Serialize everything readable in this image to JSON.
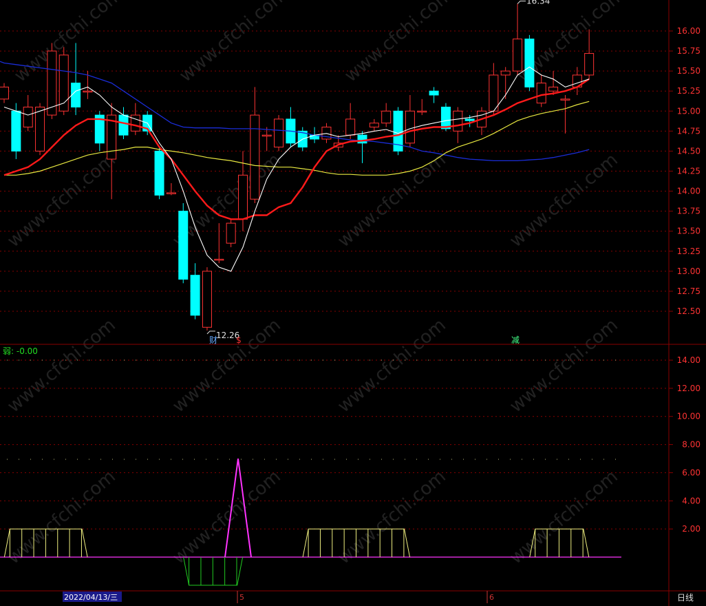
{
  "ui": {
    "indicator_label": "弱: -0.00",
    "date_box": "2022/04/13/三",
    "month_marks": [
      "5",
      "6"
    ],
    "period_tab": "日线",
    "watermark": "www.cfchi.com",
    "event_markers": [
      "财",
      "$",
      "减"
    ],
    "max_price_label": "16.34",
    "min_price_label": "12.26"
  },
  "colors": {
    "background": "#000000",
    "grid": "#8a0000",
    "axis_text": "#ff3333",
    "up": "#ff3333",
    "down": "#00ffff",
    "ma_white": "#ffffff",
    "ma_red": "#ff1a1a",
    "ma_yellow": "#e8e840",
    "ma_blue": "#1a2dd8",
    "indicator_yellow": "#f0f080",
    "indicator_green": "#22cc22",
    "indicator_magenta": "#ff33ff"
  },
  "chart_data": [
    {
      "type": "candlestick",
      "ylim": [
        12.0,
        16.3
      ],
      "yticks": [
        "12.50",
        "12.75",
        "13.00",
        "13.25",
        "13.50",
        "13.75",
        "14.00",
        "14.25",
        "14.50",
        "14.75",
        "15.00",
        "15.25",
        "15.50",
        "15.75",
        "16.00"
      ],
      "candles": [
        {
          "o": 15.15,
          "c": 15.3,
          "h": 15.35,
          "l": 15.1
        },
        {
          "o": 15.0,
          "c": 14.5,
          "h": 15.1,
          "l": 14.4
        },
        {
          "o": 14.8,
          "c": 15.05,
          "h": 15.2,
          "l": 14.75
        },
        {
          "o": 14.5,
          "c": 15.05,
          "h": 15.1,
          "l": 14.45
        },
        {
          "o": 14.95,
          "c": 15.75,
          "h": 15.85,
          "l": 14.9
        },
        {
          "o": 15.0,
          "c": 15.7,
          "h": 15.8,
          "l": 14.95
        },
        {
          "o": 15.35,
          "c": 15.05,
          "h": 15.85,
          "l": 14.95
        },
        {
          "o": 15.25,
          "c": 15.25,
          "h": 15.5,
          "l": 15.15
        },
        {
          "o": 14.95,
          "c": 14.6,
          "h": 15.0,
          "l": 14.5
        },
        {
          "o": 14.4,
          "c": 14.95,
          "h": 15.1,
          "l": 13.9
        },
        {
          "o": 14.95,
          "c": 14.7,
          "h": 15.05,
          "l": 14.65
        },
        {
          "o": 14.75,
          "c": 14.95,
          "h": 15.1,
          "l": 14.7
        },
        {
          "o": 14.95,
          "c": 14.75,
          "h": 15.0,
          "l": 14.7
        },
        {
          "o": 14.5,
          "c": 13.95,
          "h": 14.55,
          "l": 13.9
        },
        {
          "o": 13.98,
          "c": 13.98,
          "h": 14.1,
          "l": 13.95
        },
        {
          "o": 13.75,
          "c": 12.9,
          "h": 13.85,
          "l": 12.85
        },
        {
          "o": 12.95,
          "c": 12.45,
          "h": 13.1,
          "l": 12.4
        },
        {
          "o": 12.3,
          "c": 13.0,
          "h": 13.05,
          "l": 12.26
        },
        {
          "o": 13.15,
          "c": 13.15,
          "h": 13.6,
          "l": 13.1
        },
        {
          "o": 13.35,
          "c": 13.6,
          "h": 13.65,
          "l": 13.3
        },
        {
          "o": 13.65,
          "c": 14.2,
          "h": 14.5,
          "l": 13.5
        },
        {
          "o": 13.9,
          "c": 14.95,
          "h": 15.3,
          "l": 13.85
        },
        {
          "o": 14.7,
          "c": 14.7,
          "h": 14.8,
          "l": 14.5
        },
        {
          "o": 14.55,
          "c": 14.9,
          "h": 14.95,
          "l": 14.5
        },
        {
          "o": 14.9,
          "c": 14.6,
          "h": 15.05,
          "l": 14.55
        },
        {
          "o": 14.75,
          "c": 14.55,
          "h": 14.8,
          "l": 14.5
        },
        {
          "o": 14.7,
          "c": 14.65,
          "h": 14.8,
          "l": 14.6
        },
        {
          "o": 14.65,
          "c": 14.8,
          "h": 14.85,
          "l": 14.6
        },
        {
          "o": 14.55,
          "c": 14.6,
          "h": 14.7,
          "l": 14.5
        },
        {
          "o": 14.7,
          "c": 14.9,
          "h": 15.1,
          "l": 14.65
        },
        {
          "o": 14.7,
          "c": 14.6,
          "h": 14.75,
          "l": 14.35
        },
        {
          "o": 14.8,
          "c": 14.85,
          "h": 14.9,
          "l": 14.75
        },
        {
          "o": 14.85,
          "c": 15.0,
          "h": 15.1,
          "l": 14.8
        },
        {
          "o": 15.0,
          "c": 14.5,
          "h": 15.05,
          "l": 14.45
        },
        {
          "o": 14.6,
          "c": 15.0,
          "h": 15.2,
          "l": 14.55
        },
        {
          "o": 15.0,
          "c": 15.0,
          "h": 15.15,
          "l": 14.95
        },
        {
          "o": 15.25,
          "c": 15.2,
          "h": 15.3,
          "l": 15.1
        },
        {
          "o": 15.05,
          "c": 14.78,
          "h": 15.1,
          "l": 14.75
        },
        {
          "o": 14.75,
          "c": 15.0,
          "h": 15.05,
          "l": 14.6
        },
        {
          "o": 14.9,
          "c": 14.88,
          "h": 14.95,
          "l": 14.8
        },
        {
          "o": 14.8,
          "c": 15.0,
          "h": 15.05,
          "l": 14.7
        },
        {
          "o": 15.0,
          "c": 15.45,
          "h": 15.6,
          "l": 14.95
        },
        {
          "o": 15.45,
          "c": 15.5,
          "h": 15.55,
          "l": 15.15
        },
        {
          "o": 15.5,
          "c": 15.9,
          "h": 16.34,
          "l": 15.45
        },
        {
          "o": 15.9,
          "c": 15.3,
          "h": 15.95,
          "l": 15.25
        },
        {
          "o": 15.1,
          "c": 15.35,
          "h": 15.45,
          "l": 15.05
        },
        {
          "o": 15.25,
          "c": 15.3,
          "h": 15.5,
          "l": 15.2
        },
        {
          "o": 15.15,
          "c": 15.15,
          "h": 15.2,
          "l": 14.72
        },
        {
          "o": 15.3,
          "c": 15.45,
          "h": 15.55,
          "l": 15.2
        },
        {
          "o": 15.45,
          "c": 15.72,
          "h": 16.02,
          "l": 15.4
        }
      ],
      "ma_white": [
        15.05,
        15.0,
        14.95,
        15.0,
        15.05,
        15.1,
        15.25,
        15.3,
        15.2,
        15.05,
        14.95,
        14.9,
        14.85,
        14.6,
        14.4,
        14.0,
        13.55,
        13.2,
        13.05,
        13.0,
        13.3,
        13.75,
        14.15,
        14.4,
        14.55,
        14.65,
        14.7,
        14.72,
        14.68,
        14.7,
        14.72,
        14.75,
        14.77,
        14.72,
        14.78,
        14.82,
        14.85,
        14.88,
        14.9,
        14.92,
        14.95,
        15.0,
        15.2,
        15.45,
        15.55,
        15.45,
        15.4,
        15.3,
        15.35,
        15.4
      ],
      "ma_red": [
        14.2,
        14.25,
        14.3,
        14.4,
        14.55,
        14.7,
        14.82,
        14.9,
        14.9,
        14.88,
        14.85,
        14.82,
        14.78,
        14.55,
        14.4,
        14.2,
        14.0,
        13.82,
        13.7,
        13.65,
        13.65,
        13.7,
        13.7,
        13.8,
        13.85,
        14.05,
        14.3,
        14.5,
        14.58,
        14.62,
        14.63,
        14.65,
        14.68,
        14.7,
        14.75,
        14.78,
        14.8,
        14.8,
        14.82,
        14.85,
        14.9,
        14.95,
        15.02,
        15.1,
        15.15,
        15.2,
        15.22,
        15.25,
        15.3,
        15.4
      ],
      "ma_yellow": [
        14.2,
        14.2,
        14.22,
        14.25,
        14.3,
        14.35,
        14.4,
        14.45,
        14.48,
        14.5,
        14.52,
        14.55,
        14.55,
        14.52,
        14.5,
        14.48,
        14.45,
        14.42,
        14.4,
        14.38,
        14.35,
        14.32,
        14.31,
        14.3,
        14.3,
        14.28,
        14.26,
        14.23,
        14.21,
        14.21,
        14.2,
        14.2,
        14.2,
        14.22,
        14.25,
        14.3,
        14.38,
        14.48,
        14.55,
        14.6,
        14.65,
        14.72,
        14.8,
        14.88,
        14.93,
        14.97,
        15.0,
        15.03,
        15.08,
        15.12
      ],
      "ma_blue": [
        15.6,
        15.58,
        15.56,
        15.54,
        15.52,
        15.5,
        15.48,
        15.45,
        15.4,
        15.35,
        15.25,
        15.15,
        15.05,
        14.95,
        14.85,
        14.8,
        14.79,
        14.79,
        14.79,
        14.78,
        14.78,
        14.78,
        14.77,
        14.76,
        14.75,
        14.73,
        14.7,
        14.68,
        14.66,
        14.64,
        14.63,
        14.62,
        14.6,
        14.58,
        14.55,
        14.5,
        14.48,
        14.45,
        14.42,
        14.4,
        14.39,
        14.38,
        14.38,
        14.38,
        14.39,
        14.4,
        14.42,
        14.45,
        14.48,
        14.52
      ]
    },
    {
      "type": "step",
      "ylim": [
        -2,
        15
      ],
      "yticks": [
        "2.00",
        "4.00",
        "6.00",
        "8.00",
        "10.00",
        "12.00",
        "14.00"
      ],
      "values": [
        0,
        2,
        2,
        2,
        2,
        2,
        2,
        0,
        0,
        0,
        0,
        0,
        0,
        0,
        0,
        0,
        -2,
        -2,
        -2,
        -2,
        0,
        0,
        0,
        0,
        0,
        0,
        2,
        2,
        2,
        2,
        2,
        2,
        2,
        2,
        0,
        0,
        0,
        0,
        0,
        0,
        0,
        0,
        0,
        0,
        0,
        2,
        2,
        2,
        2,
        0
      ],
      "spike": {
        "index": 20,
        "value": 7
      }
    }
  ]
}
